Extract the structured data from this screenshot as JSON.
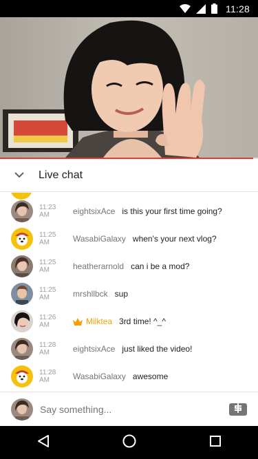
{
  "status_bar": {
    "time": "11:28",
    "icons": [
      "wifi-icon",
      "cellular-signal-icon",
      "battery-icon"
    ]
  },
  "video": {
    "progress_fraction": 0.98,
    "progress_color": "#e53935"
  },
  "chat_header": {
    "title": "Live chat",
    "collapse_icon": "chevron-down-icon"
  },
  "messages": [
    {
      "time": "11:23 AM",
      "author": "eightsixAce",
      "text": "is this your first time going?",
      "avatar": "woman-photo",
      "member": false
    },
    {
      "time": "11:25 AM",
      "author": "WasabiGalaxy",
      "text": "when's your next vlog?",
      "avatar": "yellow-cartoon",
      "member": false
    },
    {
      "time": "11:25 AM",
      "author": "heatherarnold",
      "text": "can i be a mod?",
      "avatar": "woman-photo",
      "member": false
    },
    {
      "time": "11:25 AM",
      "author": "mrshllbck",
      "text": "sup",
      "avatar": "man-photo",
      "member": false
    },
    {
      "time": "11:26 AM",
      "author": "Milktea",
      "text": "3rd time! ^_^",
      "avatar": "dark-hair-photo",
      "member": true
    },
    {
      "time": "11:28 AM",
      "author": "eightsixAce",
      "text": "just liked the video!",
      "avatar": "woman-photo",
      "member": false
    },
    {
      "time": "11:28 AM",
      "author": "WasabiGalaxy",
      "text": "awesome",
      "avatar": "yellow-cartoon",
      "member": false
    }
  ],
  "input": {
    "placeholder": "Say something..."
  },
  "colors": {
    "member_gold": "#f5a000",
    "timestamp": "#9e9e9e",
    "author": "#757575"
  },
  "nav_bar": {
    "icons": [
      "back-icon",
      "home-icon",
      "recents-icon"
    ]
  }
}
